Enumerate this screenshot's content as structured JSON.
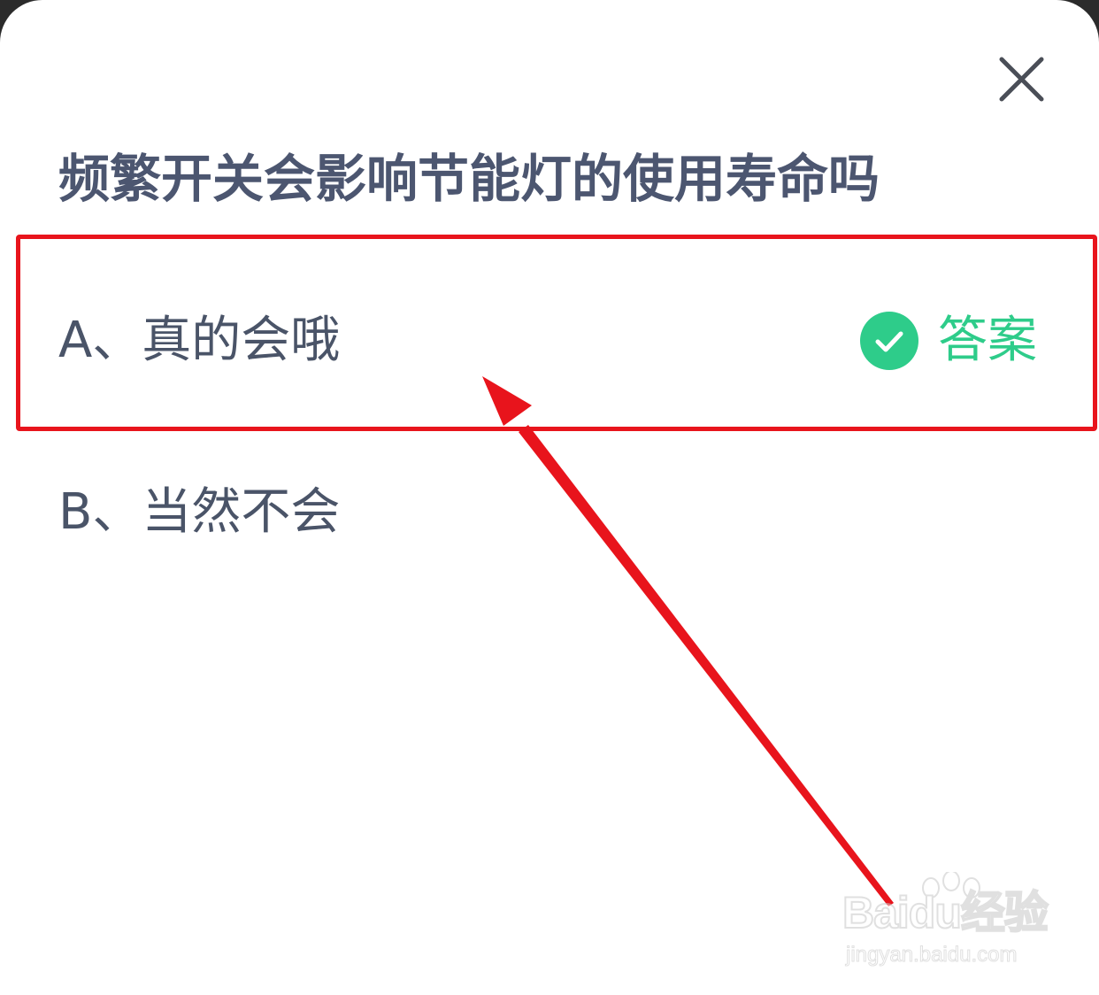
{
  "dialog": {
    "close_icon": "close-icon",
    "question": "频繁开关会影响节能灯的使用寿命吗"
  },
  "options": [
    {
      "text": "A、真的会哦",
      "is_answer": true,
      "answer_label": "答案",
      "answer_icon": "check-circle-icon"
    },
    {
      "text": "B、当然不会",
      "is_answer": false
    }
  ],
  "colors": {
    "title": "#4c5670",
    "option_text": "#4a5468",
    "answer_green": "#2ecc8a",
    "annotation_red": "#e8141c"
  },
  "watermark": {
    "logo": "Baidu经验",
    "url": "jingyan.baidu.com"
  }
}
